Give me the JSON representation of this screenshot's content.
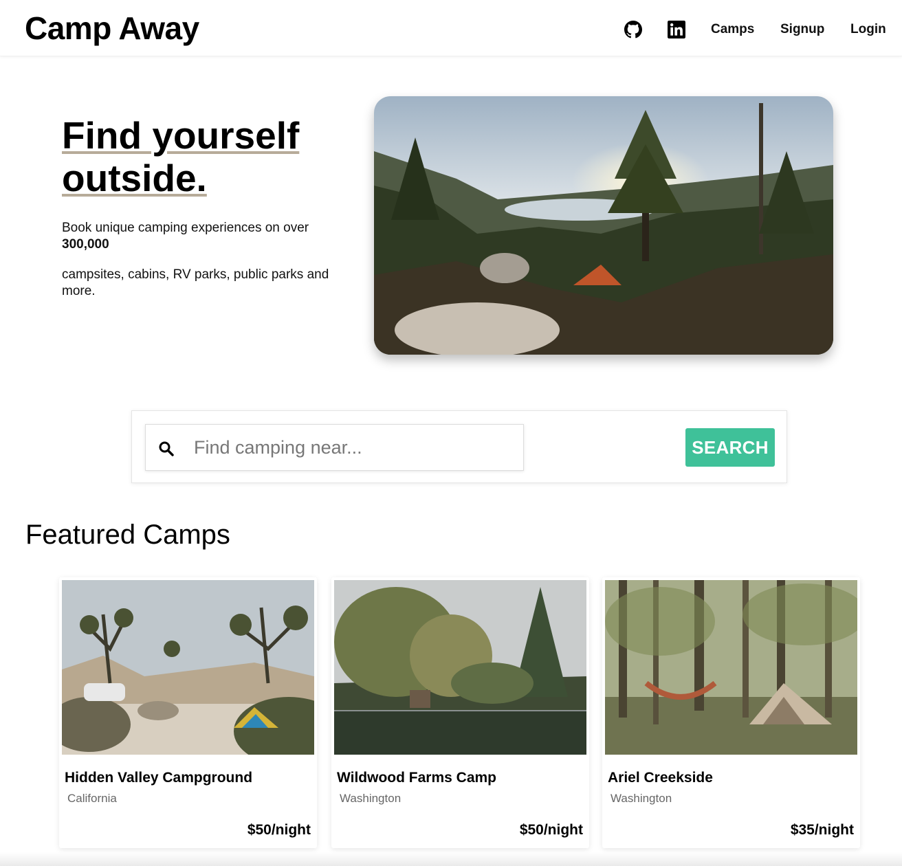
{
  "navbar": {
    "brand": "Camp Away",
    "links": [
      "Camps",
      "Signup",
      "Login"
    ],
    "icons": [
      "github-icon",
      "linkedin-icon"
    ]
  },
  "hero": {
    "title_line1": "Find yourself",
    "title_line2": "outside.",
    "text1": "Book unique camping experiences on over",
    "count": "300,000",
    "text2": "campsites, cabins, RV parks, public parks and more."
  },
  "search": {
    "placeholder": "Find camping near...",
    "button_label": "SEARCH",
    "accent_color": "#3fc199"
  },
  "featured": {
    "heading": "Featured Camps",
    "cards": [
      {
        "title": "Hidden Valley Campground",
        "location": "California",
        "price": "$50/night"
      },
      {
        "title": "Wildwood Farms Camp",
        "location": "Washington",
        "price": "$50/night"
      },
      {
        "title": "Ariel Creekside",
        "location": "Washington",
        "price": "$35/night"
      }
    ]
  }
}
